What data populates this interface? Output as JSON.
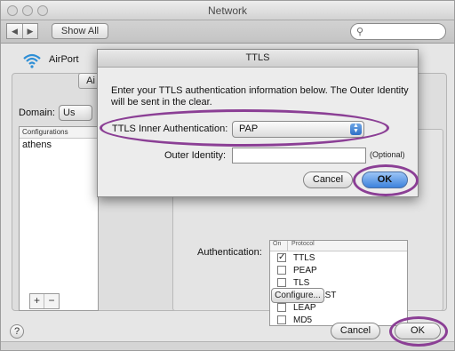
{
  "window": {
    "title": "Network"
  },
  "toolbar": {
    "show_all_label": "Show All",
    "search_placeholder": ""
  },
  "network": {
    "service_label": "AirPort",
    "tab_fragment": "Ai",
    "domain_label": "Domain:",
    "domain_value": "Us",
    "configurations_header": "Configurations",
    "configurations": [
      "athens"
    ],
    "authentication_label": "Authentication:",
    "protocol_headers": {
      "on": "On",
      "protocol": "Protocol"
    },
    "protocols": [
      {
        "name": "TTLS",
        "checked": true
      },
      {
        "name": "PEAP",
        "checked": false
      },
      {
        "name": "TLS",
        "checked": false
      },
      {
        "name": "EAP-FAST",
        "checked": false
      },
      {
        "name": "LEAP",
        "checked": false
      },
      {
        "name": "MD5",
        "checked": false
      }
    ],
    "configure_label": "Configure...",
    "add_label": "+",
    "remove_label": "−",
    "help_label": "?",
    "cancel_label": "Cancel",
    "ok_label": "OK"
  },
  "sheet": {
    "title": "TTLS",
    "message": "Enter your TTLS authentication information below. The Outer Identity will be sent in the clear.",
    "inner_auth_label": "TTLS Inner Authentication:",
    "inner_auth_value": "PAP",
    "outer_identity_label": "Outer Identity:",
    "outer_identity_value": "",
    "optional_label": "(Optional)",
    "cancel_label": "Cancel",
    "ok_label": "OK"
  },
  "colors": {
    "highlight": "#8b3f95",
    "default_button": "#3d82dc"
  }
}
